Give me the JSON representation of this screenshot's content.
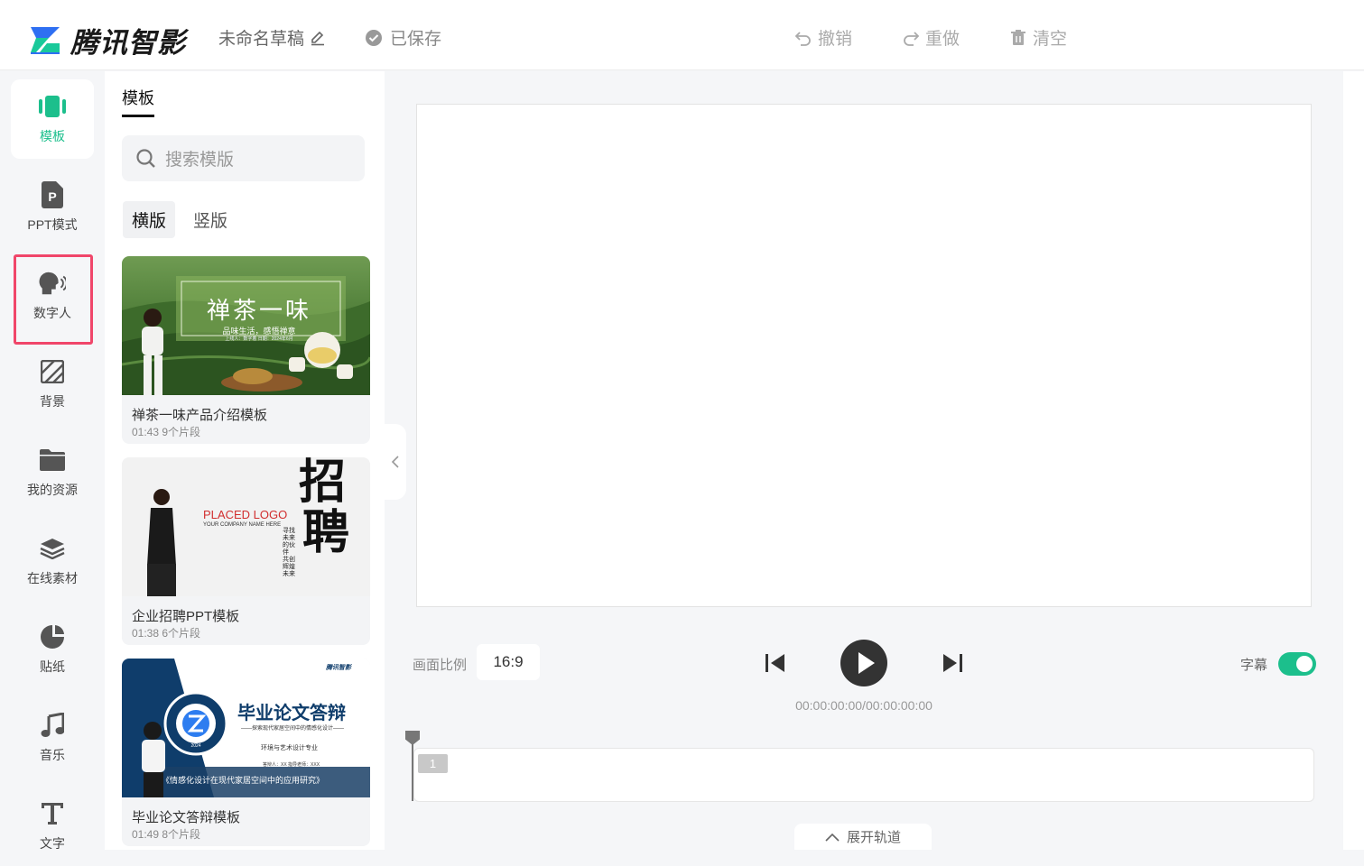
{
  "header": {
    "logo_text": "腾讯智影",
    "draft_name": "未命名草稿",
    "save_status": "已保存",
    "undo_label": "撤销",
    "redo_label": "重做",
    "clear_label": "清空"
  },
  "sidebar": {
    "items": [
      {
        "label": "模板",
        "icon": "template-icon"
      },
      {
        "label": "PPT模式",
        "icon": "ppt-icon"
      },
      {
        "label": "数字人",
        "icon": "digital-human-icon"
      },
      {
        "label": "背景",
        "icon": "background-icon"
      },
      {
        "label": "我的资源",
        "icon": "folder-icon"
      },
      {
        "label": "在线素材",
        "icon": "layers-icon"
      },
      {
        "label": "贴纸",
        "icon": "sticker-icon"
      },
      {
        "label": "音乐",
        "icon": "music-icon"
      },
      {
        "label": "文字",
        "icon": "text-icon"
      }
    ],
    "active_index": 0
  },
  "panel": {
    "tab_label": "模板",
    "search_placeholder": "搜索模版",
    "orientation": {
      "horizontal": "横版",
      "vertical": "竖版",
      "selected": "横版"
    },
    "cards": [
      {
        "title": "禅茶一味产品介绍模板",
        "meta": "01:43 9个片段",
        "thumb_heading": "禅茶一味",
        "thumb_subtitle": "品味生活，感悟禅意",
        "thumb_small": "上线人：数字着     日期：2024年6月"
      },
      {
        "title": "企业招聘PPT模板",
        "meta": "01:38 6个片段",
        "thumb_logo": "PLACED LOGO",
        "thumb_company": "YOUR COMPANY NAME HERE",
        "thumb_big1": "招",
        "thumb_big2": "聘",
        "thumb_vertical": "寻找未来的伙伴 共创辉煌未来"
      },
      {
        "title": "毕业论文答辩模板",
        "meta": "01:49 8个片段",
        "thumb_brand": "腾讯智影",
        "thumb_heading": "毕业论文答辩",
        "thumb_sub": "——探索现代家居空间中的情感化设计——",
        "thumb_dept": "环境与艺术设计专业",
        "thumb_people": "答辩人：XX   指导老师：XXX",
        "thumb_topic": "《情感化设计在现代家居空间中的应用研究》",
        "thumb_year": "2024"
      }
    ]
  },
  "player": {
    "ratio_label": "画面比例",
    "ratio_value": "16:9",
    "timecode": "00:00:00:00/00:00:00:00",
    "subtitle_label": "字幕",
    "subtitle_on": true
  },
  "timeline": {
    "clip_number": "1",
    "expand_label": "展开轨道"
  },
  "colors": {
    "accent": "#1cbf8c",
    "highlight_border": "#f0466a"
  }
}
